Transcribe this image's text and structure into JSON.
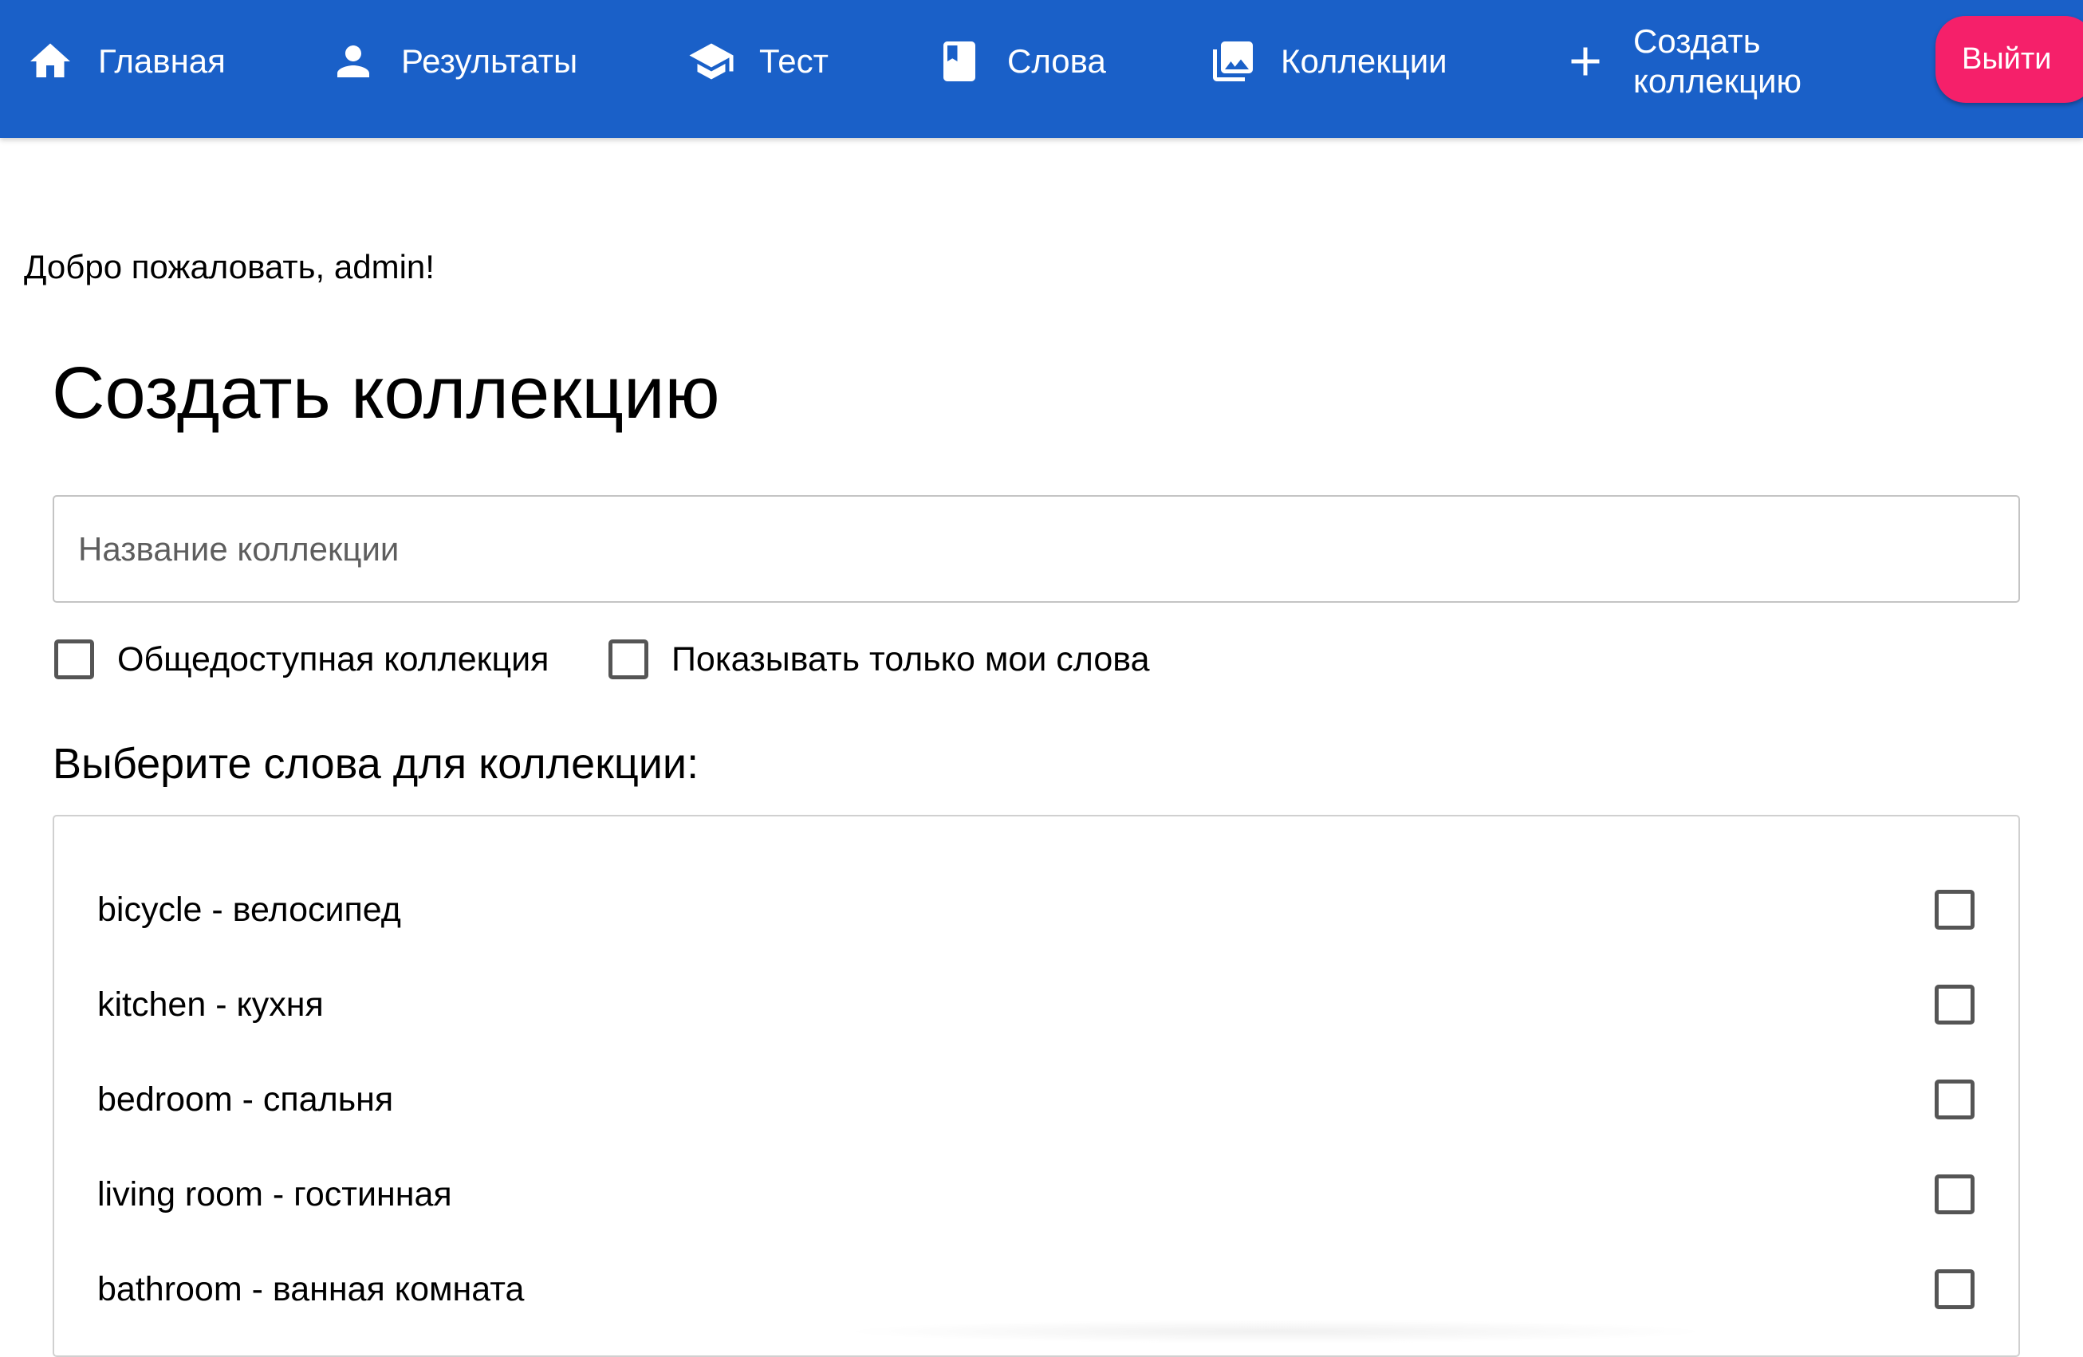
{
  "nav": {
    "items": [
      {
        "label": "Главная",
        "icon": "home-icon"
      },
      {
        "label": "Результаты",
        "icon": "person-icon"
      },
      {
        "label": "Тест",
        "icon": "graduation-cap-icon"
      },
      {
        "label": "Слова",
        "icon": "book-icon"
      },
      {
        "label": "Коллекции",
        "icon": "photo-library-icon"
      },
      {
        "label": "Создать коллекцию",
        "icon": "plus-icon"
      }
    ],
    "logout_label": "Выйти"
  },
  "welcome": "Добро пожаловать, admin!",
  "page_title": "Создать коллекцию",
  "form": {
    "name_placeholder": "Название коллекции",
    "name_value": "",
    "public_label": "Общедоступная коллекция",
    "public_checked": false,
    "only_mine_label": "Показывать только мои слова",
    "only_mine_checked": false,
    "words_heading": "Выберите слова для коллекции:",
    "words": [
      {
        "label": "bicycle - велосипед",
        "checked": false
      },
      {
        "label": "kitchen - кухня",
        "checked": false
      },
      {
        "label": "bedroom - спальня",
        "checked": false
      },
      {
        "label": "living room - гостинная",
        "checked": false
      },
      {
        "label": "bathroom - ванная комната",
        "checked": false
      }
    ]
  },
  "colors": {
    "navbar": "#1a60c8",
    "logout": "#f5206a"
  }
}
